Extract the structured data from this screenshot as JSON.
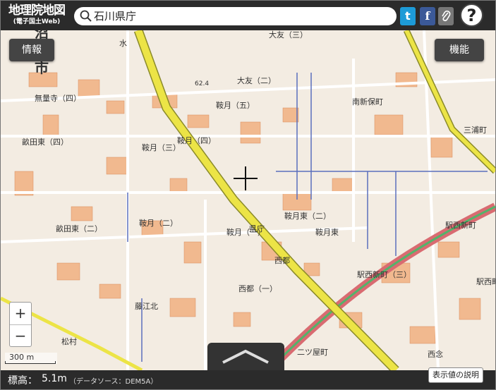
{
  "header": {
    "logo_title": "地理院地図",
    "logo_sub": "(電子国土Web)",
    "search_value": "石川県庁",
    "twitter_label": "t",
    "facebook_label": "f",
    "link_label": "",
    "help_label": "?"
  },
  "map": {
    "info_button": "情報",
    "function_button": "機能",
    "zoom_in": "+",
    "zoom_out": "−",
    "scale_label": "300 m",
    "labels": [
      "無量寺（四）",
      "大友（二）",
      "大友（三）",
      "南新保町",
      "三浦町",
      "畝田東（四）",
      "鞍月（五）",
      "鞍月（四）",
      "鞍月（三）",
      "鞍月（二）",
      "畝田東（二）",
      "鞍月（一）",
      "県庁",
      "鞍月東（二）",
      "鞍月東",
      "駅西新町",
      "駅西新町（三）",
      "西都",
      "西都（一）",
      "藤江北",
      "松村",
      "二ツ屋町",
      "西念",
      "駅西町",
      "水",
      "市",
      "沼",
      "62.4"
    ]
  },
  "footer": {
    "elev_label": "標高：",
    "elev_value": "5.1m",
    "source": "（データソース：DEM5A）",
    "explain_button": "表示値の説明"
  },
  "colors": {
    "header_bg": "#2b2b2b",
    "map_bg": "#f3ece2",
    "road_major": "#ece446",
    "rail": "#d96b71",
    "rail_inner": "#53b36a",
    "building": "#f1b98f",
    "river": "#5b6fbc"
  }
}
